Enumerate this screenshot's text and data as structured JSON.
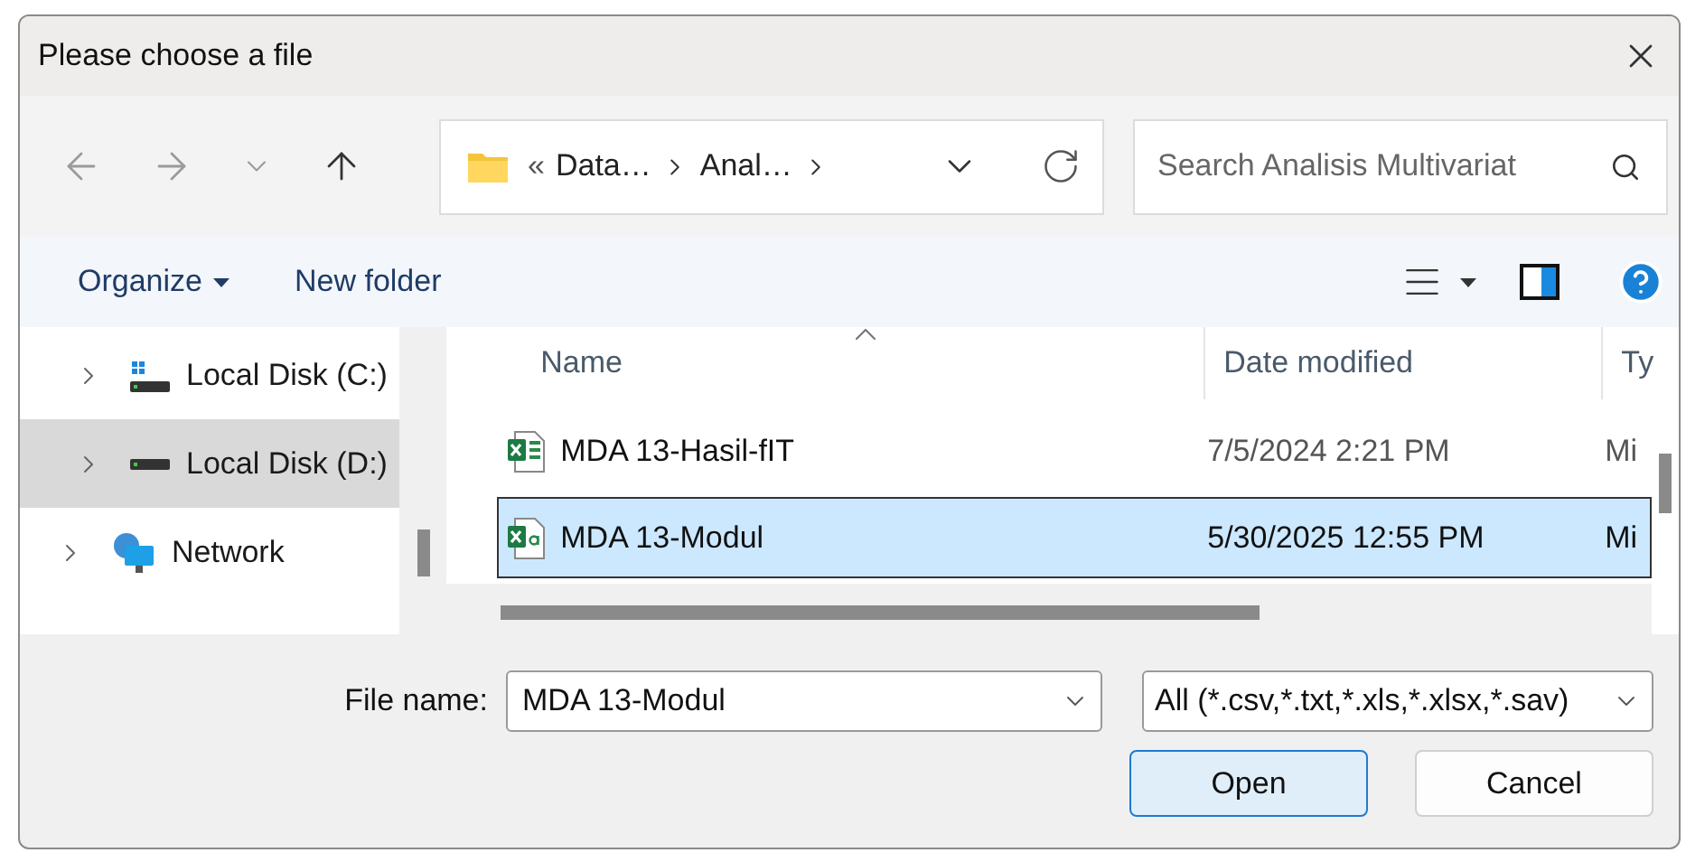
{
  "window": {
    "title": "Please choose a file"
  },
  "navigation": [
    {
      "kind": "back",
      "disabled": true
    },
    {
      "kind": "forward",
      "disabled": true
    },
    {
      "kind": "recent",
      "disabled": true
    },
    {
      "kind": "up",
      "disabled": false
    }
  ],
  "address_bar": {
    "overflow": "«",
    "segments": [
      "Data…",
      "Anal…"
    ]
  },
  "search": {
    "placeholder": "Search Analisis Multivariat"
  },
  "toolbar": {
    "organize": "Organize",
    "new_folder": "New folder"
  },
  "sidebar": {
    "items": [
      {
        "label": "Local Disk (C:)",
        "kind": "system-disk",
        "selected": false
      },
      {
        "label": "Local Disk (D:)",
        "kind": "disk",
        "selected": true
      },
      {
        "label": "Network",
        "kind": "network",
        "selected": false
      }
    ]
  },
  "table": {
    "columns": [
      {
        "label": "Name",
        "sorted": true
      },
      {
        "label": "Date modified",
        "sorted": false
      },
      {
        "label": "Ty",
        "sorted": false
      }
    ],
    "rows": [
      {
        "name": "MDA 13-Hasil-fIT",
        "date": "7/5/2024 2:21 PM",
        "type": "Mi",
        "kind": "workbook",
        "selected": false
      },
      {
        "name": "MDA 13-Modul",
        "date": "5/30/2025 12:55 PM",
        "type": "Mi",
        "kind": "csv",
        "selected": true
      }
    ]
  },
  "file_name": {
    "label": "File name:",
    "value": "MDA 13-Modul"
  },
  "file_type": {
    "value": "All (*.csv,*.txt,*.xls,*.xlsx,*.sav)"
  },
  "buttons": [
    {
      "label": "Open",
      "default": true
    },
    {
      "label": "Cancel",
      "default": false
    }
  ]
}
